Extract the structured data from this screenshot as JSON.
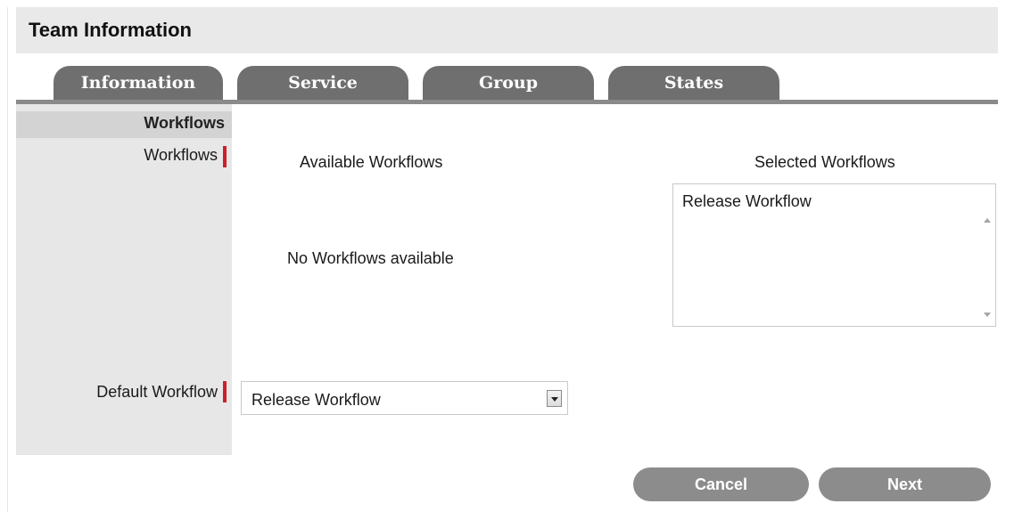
{
  "header": {
    "title": "Team Information"
  },
  "tabs": [
    {
      "label": "Information"
    },
    {
      "label": "Service"
    },
    {
      "label": "Group"
    },
    {
      "label": "States"
    }
  ],
  "sidebar": {
    "section_title": "Workflows"
  },
  "form": {
    "workflows_label": "Workflows",
    "available_heading": "Available Workflows",
    "available_empty": "No Workflows available",
    "selected_heading": "Selected Workflows",
    "selected_items": [
      "Release Workflow"
    ],
    "default_label": "Default Workflow",
    "default_value": "Release Workflow"
  },
  "buttons": {
    "cancel": "Cancel",
    "next": "Next"
  },
  "colors": {
    "tab_bg": "#6f6f6f",
    "required_marker": "#cc1f2a",
    "button_bg": "#8c8c8c",
    "header_bg": "#e9e9e9",
    "sidebar_bg": "#e7e7e7"
  }
}
